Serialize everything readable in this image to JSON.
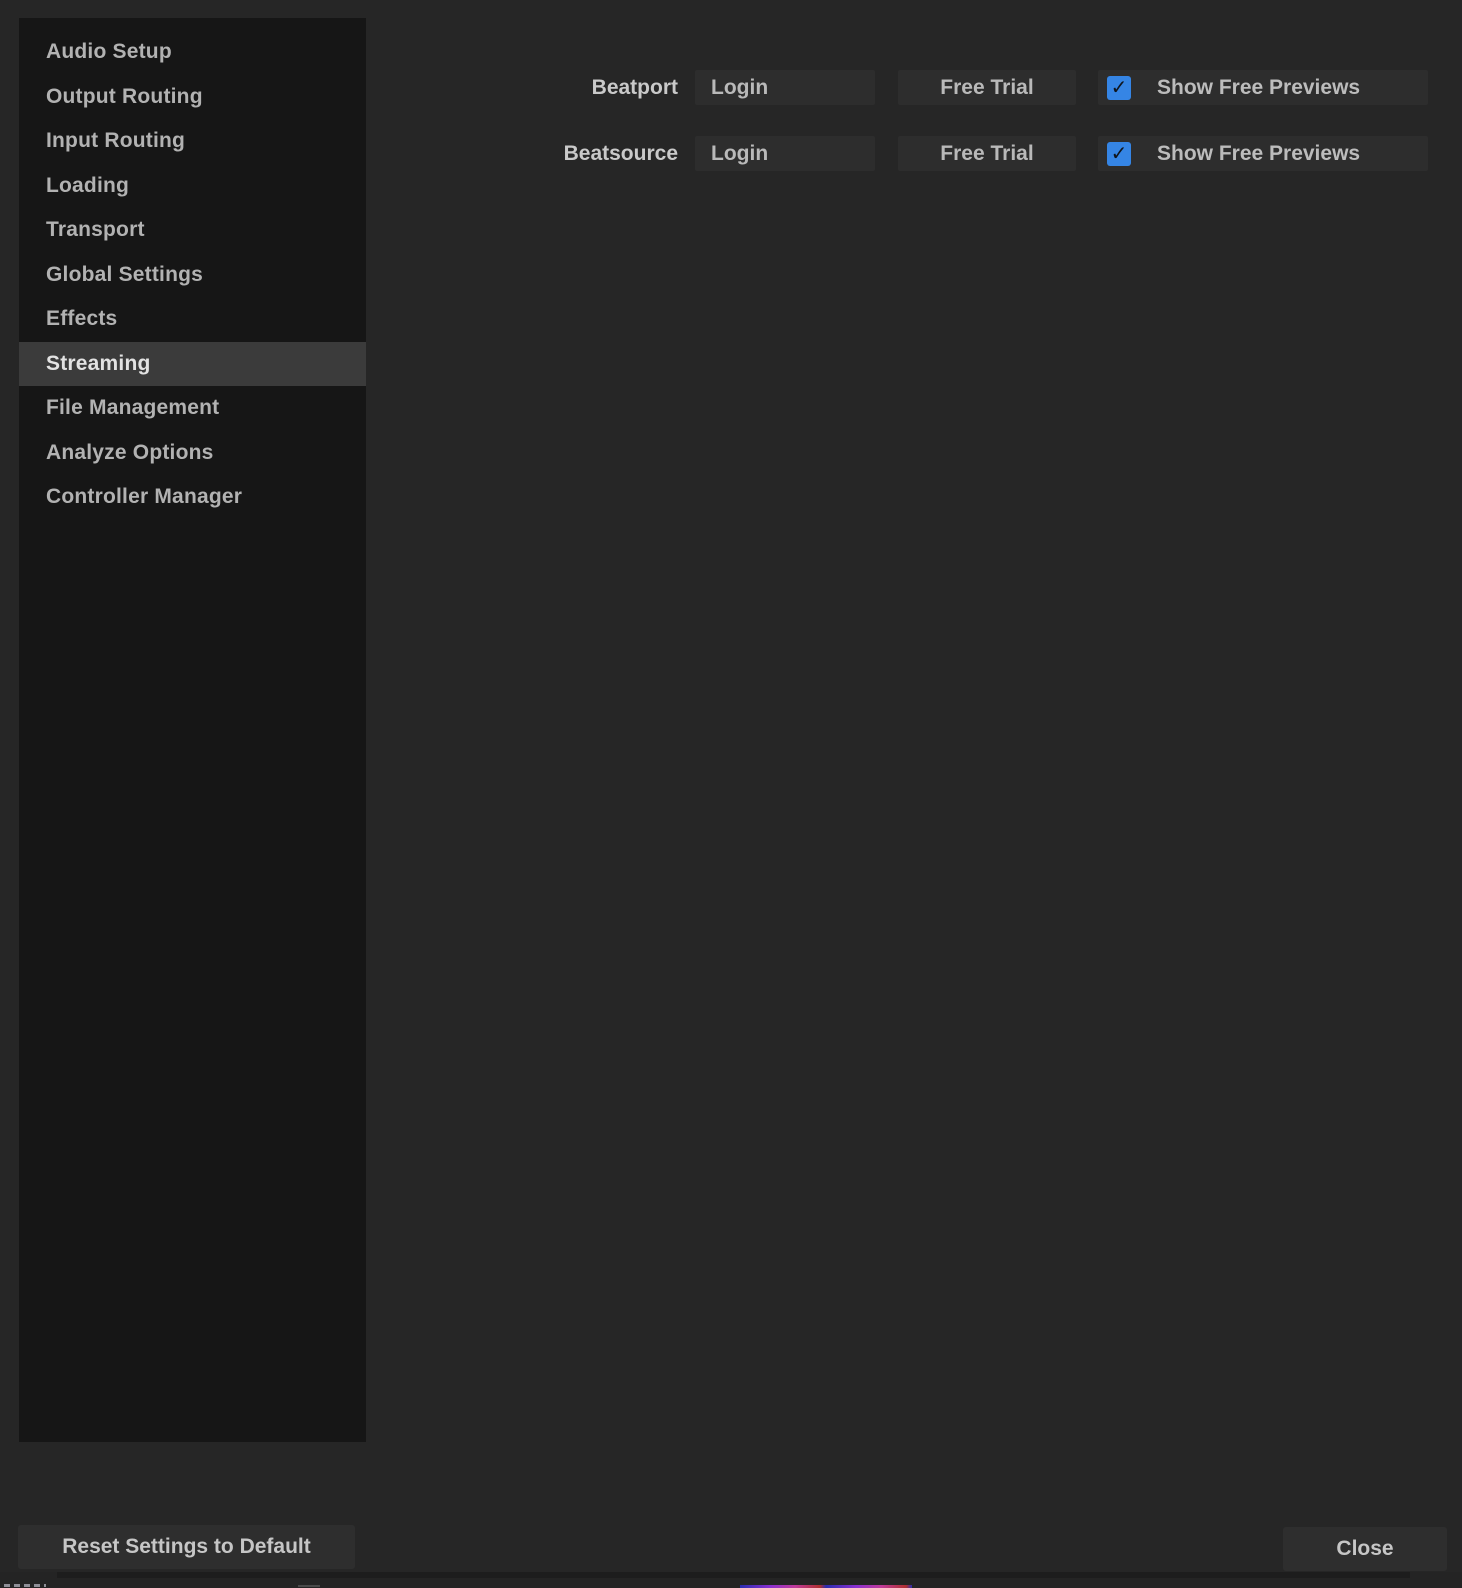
{
  "sidebar": {
    "items": [
      {
        "label": "Audio Setup",
        "selected": false
      },
      {
        "label": "Output Routing",
        "selected": false
      },
      {
        "label": "Input Routing",
        "selected": false
      },
      {
        "label": "Loading",
        "selected": false
      },
      {
        "label": "Transport",
        "selected": false
      },
      {
        "label": "Global Settings",
        "selected": false
      },
      {
        "label": "Effects",
        "selected": false
      },
      {
        "label": "Streaming",
        "selected": true
      },
      {
        "label": "File Management",
        "selected": false
      },
      {
        "label": "Analyze Options",
        "selected": false
      },
      {
        "label": "Controller Manager",
        "selected": false
      }
    ]
  },
  "streaming_panel": {
    "rows": [
      {
        "label": "Beatport",
        "login_label": "Login",
        "trial_label": "Free Trial",
        "preview_label": "Show Free Previews",
        "preview_checked": true
      },
      {
        "label": "Beatsource",
        "login_label": "Login",
        "trial_label": "Free Trial",
        "preview_label": "Show Free Previews",
        "preview_checked": true
      }
    ]
  },
  "footer": {
    "reset_label": "Reset Settings to Default",
    "close_label": "Close"
  },
  "icons": {
    "check_glyph": "✓"
  },
  "colors": {
    "dialog_background": "#262626",
    "sidebar_background": "#161616",
    "selected_item_background": "#3b3b3b",
    "button_background": "#2d2d2d",
    "checkbox_blue": "#3585e5",
    "text_primary": "#c9c9c9",
    "text_selected": "#e2e2e2"
  }
}
